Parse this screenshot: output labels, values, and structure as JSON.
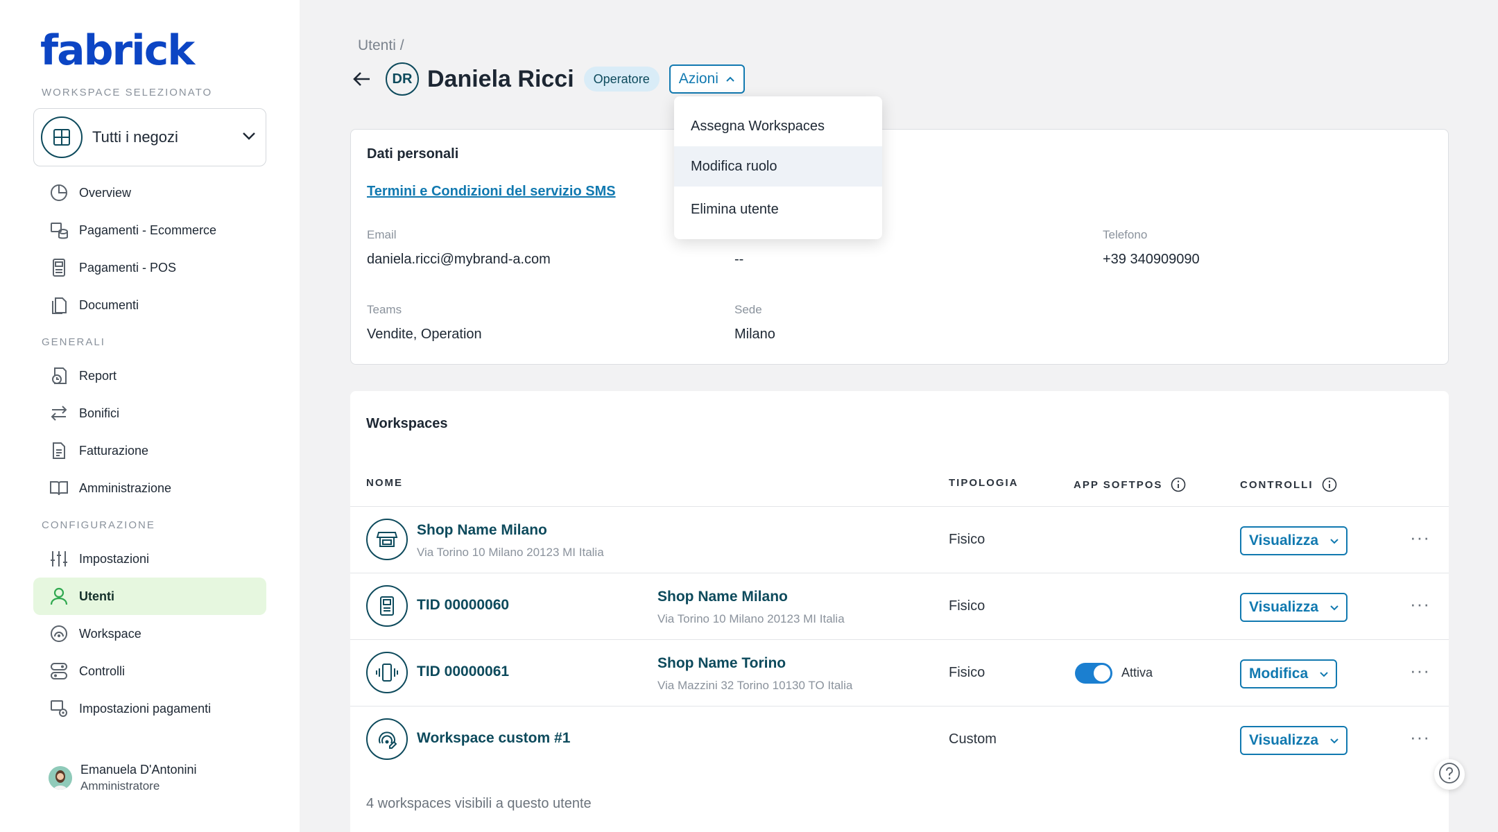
{
  "app": {
    "logo": "fabrick"
  },
  "sidebar": {
    "workspace_caption": "WORKSPACE SELEZIONATO",
    "workspace_select": "Tutti i negozi",
    "items_top": [
      {
        "label": "Overview",
        "icon": "pie-chart-icon"
      },
      {
        "label": "Pagamenti - Ecommerce",
        "icon": "cart-coins-icon"
      },
      {
        "label": "Pagamenti - POS",
        "icon": "pos-terminal-icon"
      },
      {
        "label": "Documenti",
        "icon": "documents-icon"
      }
    ],
    "section_generali": "GENERALI",
    "items_generali": [
      {
        "label": "Report",
        "icon": "report-icon"
      },
      {
        "label": "Bonifici",
        "icon": "transfer-arrows-icon"
      },
      {
        "label": "Fatturazione",
        "icon": "invoice-icon"
      },
      {
        "label": "Amministrazione",
        "icon": "book-icon"
      }
    ],
    "section_configurazione": "CONFIGURAZIONE",
    "items_config": [
      {
        "label": "Impostazioni",
        "icon": "sliders-icon"
      },
      {
        "label": "Utenti",
        "icon": "user-icon",
        "active": true
      },
      {
        "label": "Workspace",
        "icon": "workspace-icon"
      },
      {
        "label": "Controlli",
        "icon": "toggles-icon"
      },
      {
        "label": "Impostazioni pagamenti",
        "icon": "payment-settings-icon"
      }
    ],
    "user": {
      "name": "Emanuela D'Antonini",
      "role": "Amministratore"
    }
  },
  "header": {
    "breadcrumb": "Utenti /",
    "initials": "DR",
    "name": "Daniela Ricci",
    "role_badge": "Operatore",
    "actions_label": "Azioni"
  },
  "dropdown": {
    "items": [
      "Assegna Workspaces",
      "Modifica ruolo",
      "Elimina utente"
    ],
    "hovered_index": 1
  },
  "personal": {
    "title": "Dati personali",
    "terms_link": "Termini e Condizioni del servizio SMS",
    "email_label": "Email",
    "email_value": "daniela.ricci@mybrand-a.com",
    "middle_value": "--",
    "phone_label": "Telefono",
    "phone_value": "+39 340909090",
    "teams_label": "Teams",
    "teams_value": "Vendite, Operation",
    "sede_label": "Sede",
    "sede_value": "Milano"
  },
  "workspaces": {
    "title": "Workspaces",
    "columns": {
      "nome": "NOME",
      "tipologia": "TIPOLOGIA",
      "softpos": "APP SOFTPOS",
      "controlli": "CONTROLLI"
    },
    "rows": [
      {
        "icon": "store-icon",
        "name": "Shop Name Milano",
        "address": "Via Torino 10 Milano 20123 MI Italia",
        "shop": "",
        "shop_address": "",
        "type": "Fisico",
        "softpos": "",
        "control": "Visualizza"
      },
      {
        "icon": "pos-terminal-icon",
        "name": "TID 00000060",
        "address": "",
        "shop": "Shop Name Milano",
        "shop_address": "Via Torino 10 Milano 20123 MI Italia",
        "type": "Fisico",
        "softpos": "",
        "control": "Visualizza"
      },
      {
        "icon": "vibrating-phone-icon",
        "name": "TID 00000061",
        "address": "",
        "shop": "Shop Name Torino",
        "shop_address": "Via Mazzini 32 Torino 10130 TO Italia",
        "type": "Fisico",
        "softpos": "Attiva",
        "control": "Modifica"
      },
      {
        "icon": "custom-workspace-icon",
        "name": "Workspace custom #1",
        "address": "",
        "shop": "",
        "shop_address": "",
        "type": "Custom",
        "softpos": "",
        "control": "Visualizza"
      }
    ],
    "footer": "4 workspaces visibili a questo utente"
  },
  "colors": {
    "brand": "#0c45c4",
    "accent": "#1179b0",
    "dark_teal": "#0d4a5c",
    "active_nav": "#e6f7df",
    "toggle_on": "#1b7fd0"
  }
}
